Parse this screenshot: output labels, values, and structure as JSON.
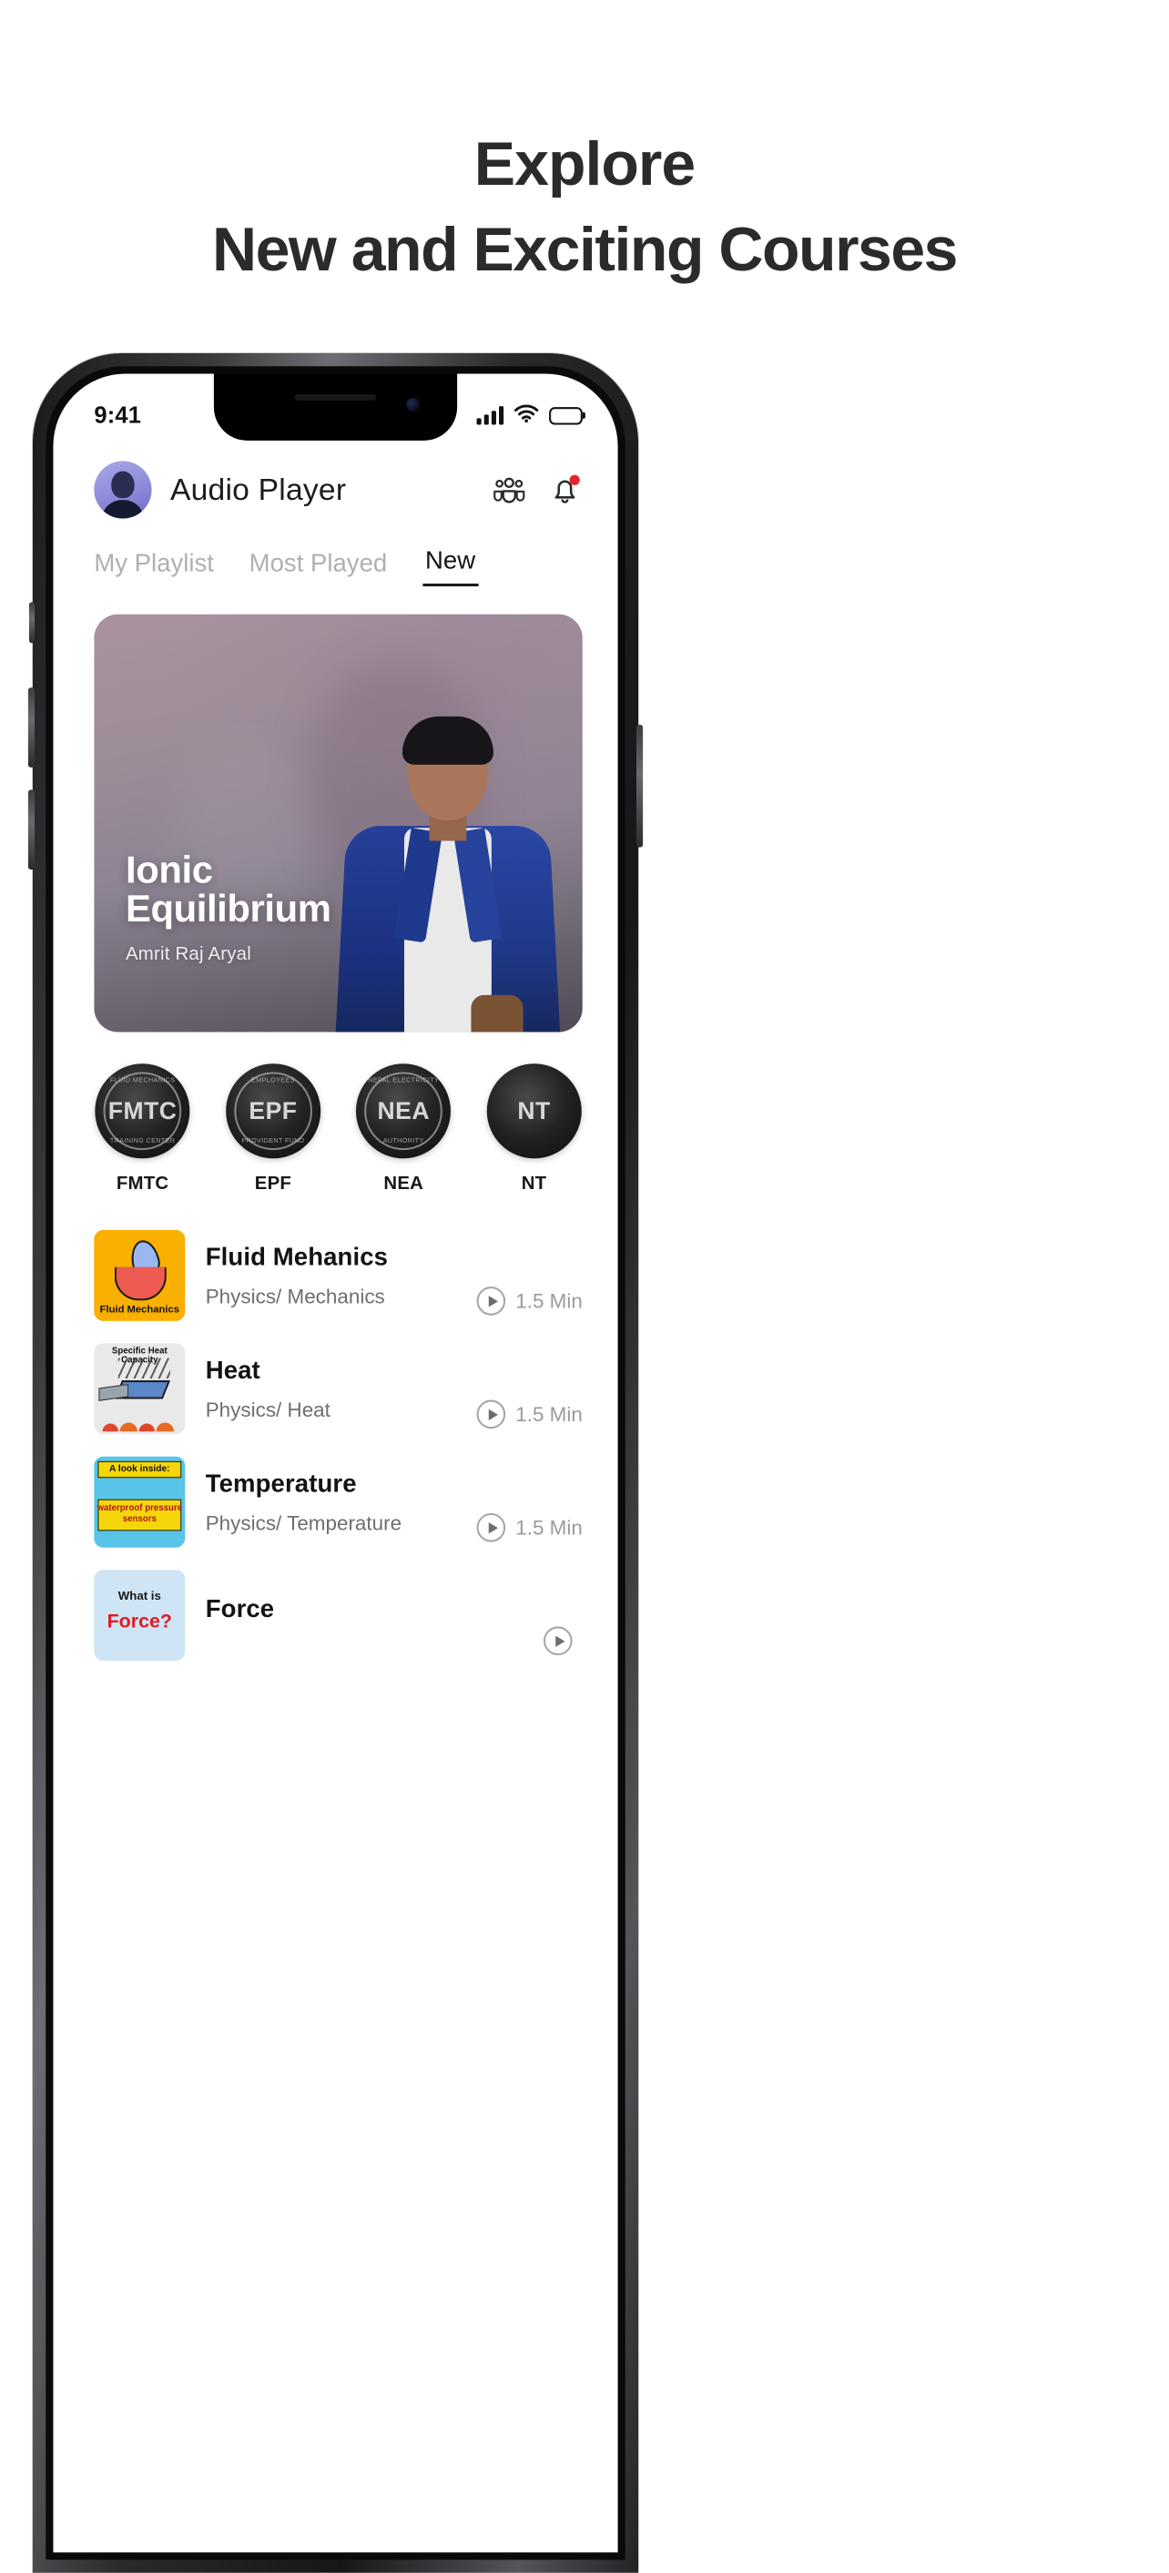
{
  "heading": {
    "line1": "Explore",
    "line2": "New and Exciting Courses"
  },
  "status_bar": {
    "time": "9:41",
    "signal_icon": "cellular-signal-icon",
    "wifi_icon": "wifi-icon",
    "battery_icon": "battery-icon"
  },
  "header": {
    "avatar_alt": "user-avatar",
    "title": "Audio Player",
    "actions": [
      {
        "name": "group-icon",
        "label": "Group"
      },
      {
        "name": "bell-icon",
        "label": "Notifications",
        "badge": true
      }
    ]
  },
  "tabs": [
    {
      "label": "My Playlist",
      "active": false
    },
    {
      "label": "Most Played",
      "active": false
    },
    {
      "label": "New",
      "active": true
    }
  ],
  "hero": {
    "title_line1": "Ionic",
    "title_line2": "Equilibrium",
    "instructor": "Amrit Raj Aryal"
  },
  "categories": [
    {
      "label": "FMTC",
      "sym": "FMTC",
      "arc_top": "FLUID MECHANICS",
      "arc_bot": "TRAINING CENTER"
    },
    {
      "label": "EPF",
      "sym": "EPF",
      "arc_top": "EMPLOYEES",
      "arc_bot": "PROVIDENT FUND"
    },
    {
      "label": "NEA",
      "sym": "NEA",
      "arc_top": "NEPAL ELECTRICITY",
      "arc_bot": "AUTHORITY"
    },
    {
      "label": "NT",
      "sym": "NT",
      "arc_top": "",
      "arc_bot": ""
    }
  ],
  "courses": [
    {
      "title": "Fluid Mehanics",
      "subtitle": "Physics/ Mechanics",
      "duration": "1.5 Min",
      "thumb_label": "Fluid Mechanics",
      "thumb_style": "thumb-fluid",
      "thumb_color": "#f9b000"
    },
    {
      "title": "Heat",
      "subtitle": "Physics/ Heat",
      "duration": "1.5 Min",
      "thumb_label": "Specific Heat Capacity",
      "thumb_style": "thumb-heat",
      "thumb_color": "#e9e9ea"
    },
    {
      "title": "Temperature",
      "subtitle": "Physics/ Temperature",
      "duration": "1.5 Min",
      "thumb_label": "A look inside:",
      "thumb_label2": "waterproof pressure sensors",
      "thumb_style": "thumb-temp",
      "thumb_color": "#57c4e8"
    },
    {
      "title": "Force",
      "subtitle": "",
      "duration": "",
      "thumb_label": "What is",
      "thumb_label2": "Force?",
      "thumb_style": "thumb-force",
      "thumb_color": "#cfe4f4"
    }
  ],
  "colors": {
    "text_primary": "#131315",
    "text_muted": "#6e6e73",
    "tab_inactive": "#b0b0b4",
    "notification_dot": "#e8232a",
    "accent_yellow": "#f9b000"
  }
}
